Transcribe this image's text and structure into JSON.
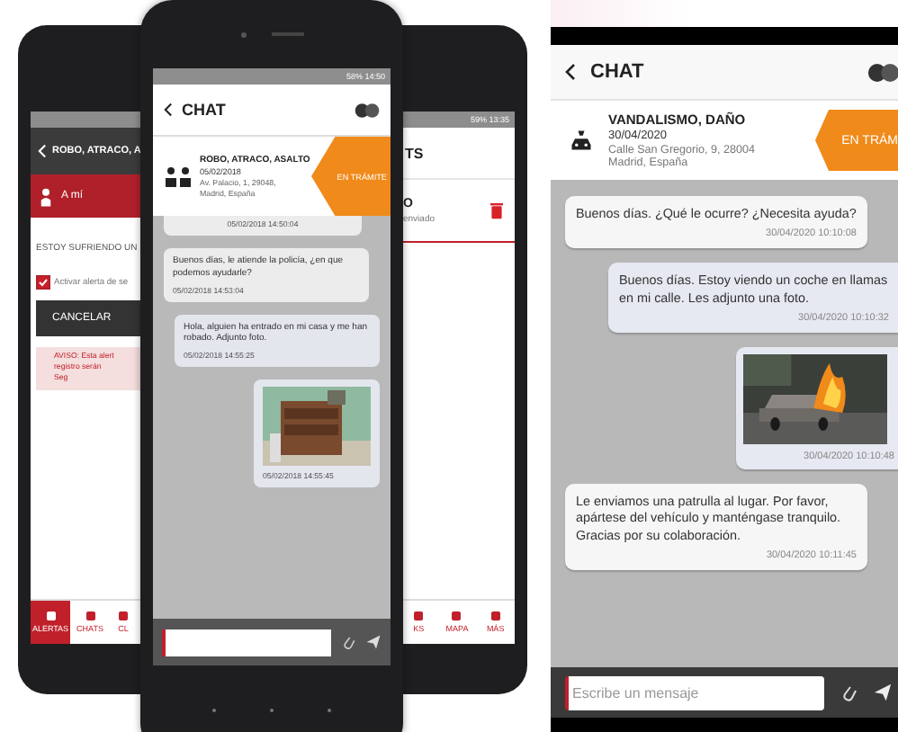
{
  "alert_phone": {
    "header_title": "ROBO, ATRACO, A",
    "target": "A mí",
    "prompt": "ESTOY SUFRIENDO UN",
    "alert_checkbox": {
      "label": "Activar alerta de se",
      "checked": true
    },
    "cancel_button": "CANCELAR",
    "warning": [
      "AVISO: Esta alert",
      "registro serán",
      "Seg"
    ],
    "nav": [
      {
        "label": "ALERTAS",
        "selected": true
      },
      {
        "label": "CHATS",
        "selected": false
      },
      {
        "label": "CL",
        "selected": false
      }
    ]
  },
  "chat_phone": {
    "status_time": "14:50",
    "battery": "58%",
    "title": "CHAT",
    "incident": {
      "title": "ROBO, ATRACO, ASALTO",
      "date": "05/02/2018",
      "address": "Av. Palacio, 1, 29048, Madrid, España",
      "status": "EN TRÁMITE"
    },
    "messages": [
      {
        "kind": "incoming",
        "time": "05/02/2018 14:50:04"
      },
      {
        "kind": "incoming",
        "text": "Buenos días, le atiende la policía, ¿en que podemos ayudarle?",
        "time": "05/02/2018 14:53:04"
      },
      {
        "kind": "outgoing",
        "text": "Hola, alguien ha entrado en mi casa y me han robado. Adjunto foto.",
        "time": "05/02/2018 14:55:25"
      },
      {
        "time": "05/02/2018 14:55:45"
      }
    ]
  },
  "list_phone": {
    "status_time": "13:35",
    "battery": "59%",
    "header_title": "TS",
    "item_title": "O",
    "item_status": "enviado",
    "nav": [
      {
        "label": "KS",
        "selected": false
      },
      {
        "label": "MAPA",
        "selected": false
      },
      {
        "label": "MÁS",
        "selected": false
      }
    ]
  },
  "chat_screen": {
    "title": "CHAT",
    "incident": {
      "title": "VANDALISMO, DAÑO",
      "date": "30/04/2020",
      "address": "Calle San Gregorio, 9, 28004 Madrid, España",
      "status": "EN TRÁM"
    },
    "messages": [
      {
        "kind": "incoming",
        "text": "Buenos días. ¿Qué le ocurre? ¿Necesita ayuda?",
        "time": "30/04/2020 10:10:08"
      },
      {
        "kind": "outgoing",
        "text": "Buenos días. Estoy viendo un coche en llamas en mi calle. Les adjunto una foto.",
        "time": "30/04/2020 10:10:32"
      },
      {
        "time": "30/04/2020 10:10:48"
      },
      {
        "kind": "incoming",
        "text": "Le enviamos una patrulla al lugar. Por favor, apártese del vehículo y manténgase tranquilo. Gracias por su colaboración.",
        "time": "30/04/2020 10:11:45"
      }
    ],
    "input": {
      "placeholder": "Escribe un mensaje"
    }
  }
}
